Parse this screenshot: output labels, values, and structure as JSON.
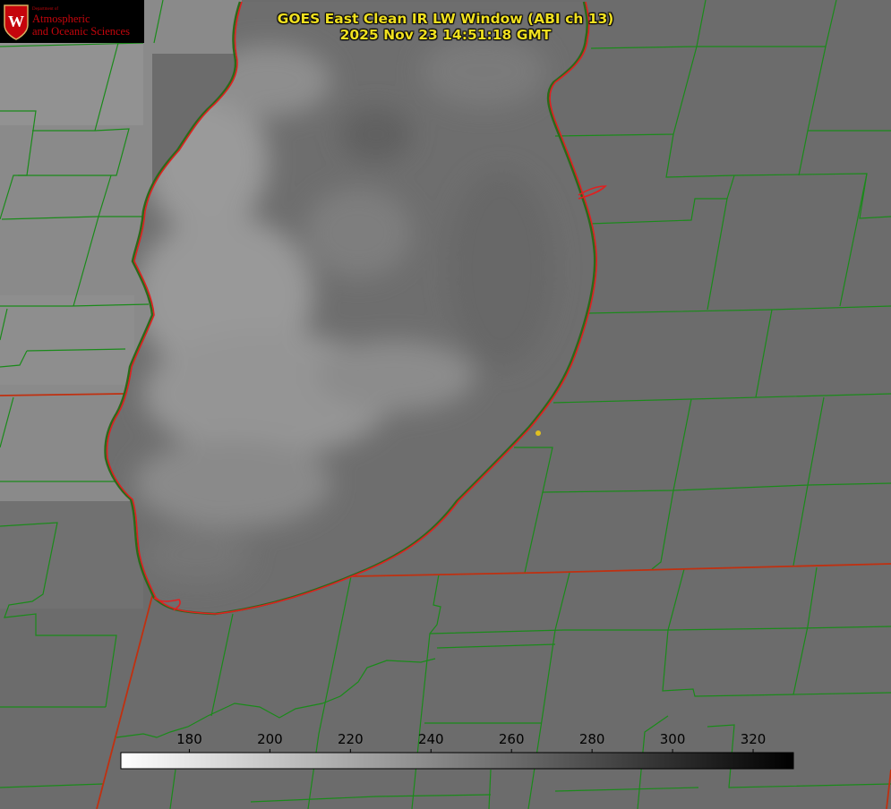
{
  "logo": {
    "department": "Department of",
    "line1": "Atmospheric",
    "line2": "and Oceanic Sciences",
    "seal_letter": "W"
  },
  "title": {
    "line1": "GOES East Clean IR LW Window (ABI ch 13)",
    "line2": "2025 Nov 23 14:51:18 GMT"
  },
  "colorbar": {
    "ticks": [
      180,
      200,
      220,
      240,
      260,
      280,
      300,
      320
    ],
    "range": [
      163,
      330
    ],
    "gradient": [
      "#ffffff",
      "#000000"
    ]
  },
  "colors": {
    "title": "#f0e020",
    "county_lines": "#1a8a1a",
    "state_lines": "#d03010",
    "shoreline": "#e02020",
    "marker": "#e0c020",
    "logo_text": "#c5050c"
  }
}
